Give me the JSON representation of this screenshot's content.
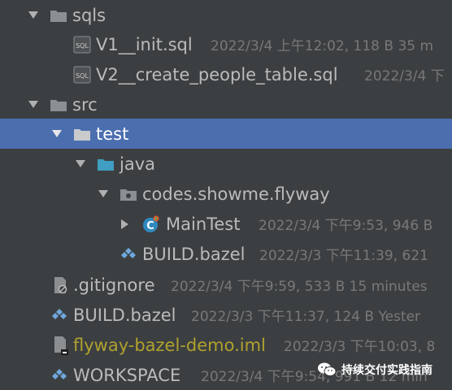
{
  "tree": [
    {
      "label": "sqls",
      "meta": "",
      "type": "folder",
      "expanded": true
    },
    {
      "label": "V1__init.sql",
      "meta": "2022/3/4 上午12:02, 118 B 35 m",
      "type": "sql-file"
    },
    {
      "label": "V2__create_people_table.sql",
      "meta": "2022/3/4 下",
      "type": "sql-file"
    },
    {
      "label": "src",
      "meta": "",
      "type": "folder",
      "expanded": true
    },
    {
      "label": "test",
      "meta": "",
      "type": "folder",
      "expanded": true,
      "selected": true
    },
    {
      "label": "java",
      "meta": "",
      "type": "source-folder",
      "expanded": true
    },
    {
      "label": "codes.showme.flyway",
      "meta": "",
      "type": "package",
      "expanded": true
    },
    {
      "label": "MainTest",
      "meta": "2022/3/4 下午9:53, 946 B",
      "type": "class",
      "expanded": false
    },
    {
      "label": "BUILD.bazel",
      "meta": "2022/3/3 下午11:39, 621",
      "type": "bazel-file"
    },
    {
      "label": ".gitignore",
      "meta": "2022/3/4 下午9:59, 533 B 15 minutes",
      "type": "gitignore-file"
    },
    {
      "label": "BUILD.bazel",
      "meta": "2022/3/3 下午11:37, 124 B Yester",
      "type": "bazel-file"
    },
    {
      "label": "flyway-bazel-demo.iml",
      "meta": "2022/3/3 下午10:03, 8",
      "type": "iml-file"
    },
    {
      "label": "WORKSPACE",
      "meta": "2022/3/4 下午9:54, 991 B 12 min",
      "type": "bazel-file"
    }
  ],
  "watermark": {
    "text": "持续交付实践指南",
    "icon": "wechat-logo-icon"
  },
  "colors": {
    "background": "#3c3f41",
    "selection": "#4b6eaf",
    "text": "#bbbbbb",
    "meta": "#787878",
    "unversioned": "#b0a12f",
    "folder": "#8c8f91",
    "source-folder": "#3f9ec2",
    "bazel": "#6fa8dc"
  }
}
